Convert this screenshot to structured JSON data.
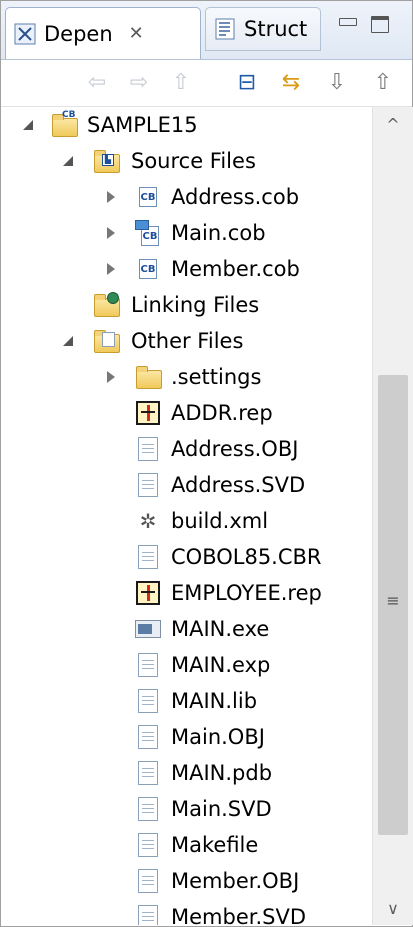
{
  "tabs": [
    {
      "label": "Depen",
      "close": "✕"
    },
    {
      "label": "Struct"
    }
  ],
  "toolbar": {
    "back_icon": "⇦",
    "forward_icon": "⇨",
    "up_icon": "⇧",
    "collapse_icon": "⊟",
    "link_icon": "⇆",
    "filter1_icon": "⇩",
    "filter2_icon": "⇧"
  },
  "tree": {
    "project": "SAMPLE15",
    "source_folder": "Source Files",
    "source_files": [
      "Address.cob",
      "Main.cob",
      "Member.cob"
    ],
    "linking_folder": "Linking Files",
    "other_folder": "Other Files",
    "other_items": [
      ".settings",
      "ADDR.rep",
      "Address.OBJ",
      "Address.SVD",
      "build.xml",
      "COBOL85.CBR",
      "EMPLOYEE.rep",
      "MAIN.exe",
      "MAIN.exp",
      "MAIN.lib",
      "Main.OBJ",
      "MAIN.pdb",
      "Main.SVD",
      "Makefile",
      "Member.OBJ",
      "Member.SVD"
    ]
  },
  "scrollbar": {
    "up": "^",
    "down": "∨",
    "grip": "≡"
  }
}
